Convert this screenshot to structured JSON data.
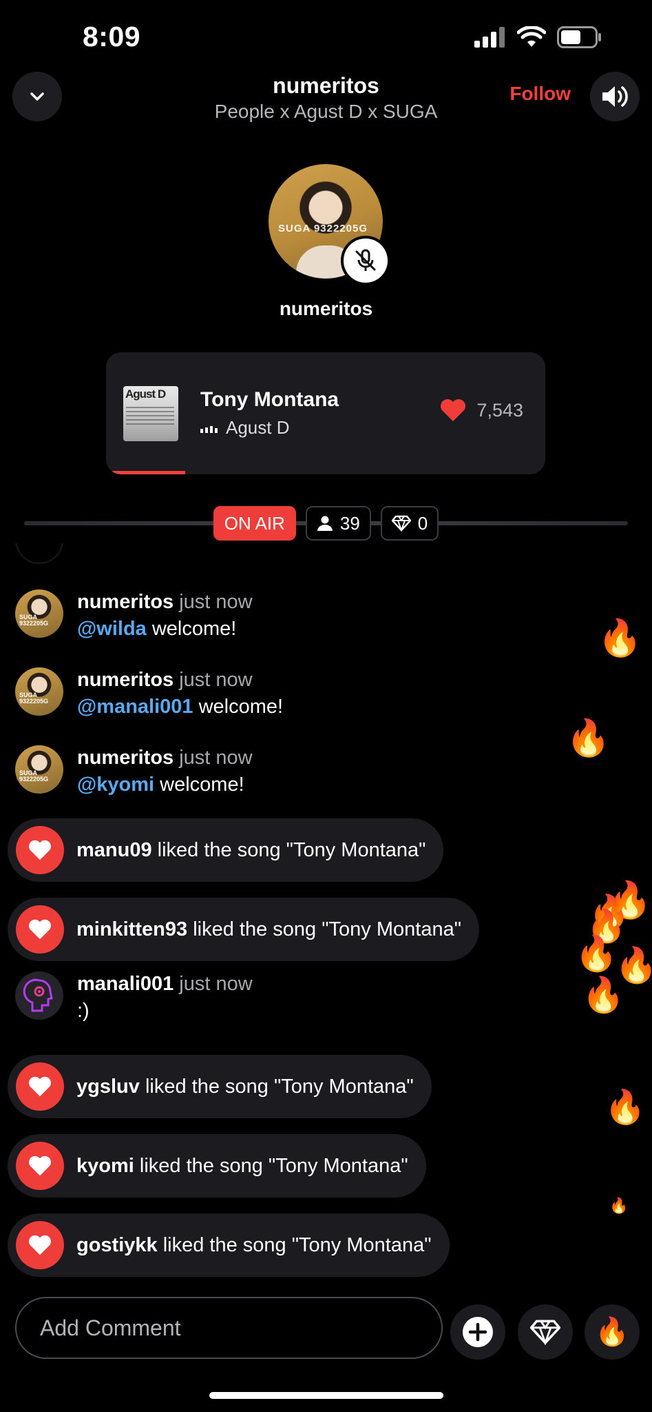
{
  "status_bar": {
    "time": "8:09"
  },
  "header": {
    "title": "numeritos",
    "subtitle": "People x Agust D x SUGA",
    "follow_label": "Follow"
  },
  "host": {
    "name": "numeritos",
    "avatar_text": "SUGA 9322205G",
    "muted": true
  },
  "now_playing": {
    "art_text": "Agust D",
    "title": "Tony Montana",
    "artist": "Agust D",
    "likes": "7,543",
    "progress": 0.18
  },
  "live_stats": {
    "on_air_label": "ON AIR",
    "listeners": "39",
    "diamonds": "0"
  },
  "chat": {
    "messages": [
      {
        "user": "numeritos",
        "time": "just now",
        "mention": "@wilda",
        "text": "welcome!"
      },
      {
        "user": "numeritos",
        "time": "just now",
        "mention": "@manali001",
        "text": "welcome!"
      },
      {
        "user": "numeritos",
        "time": "just now",
        "mention": "@kyomi",
        "text": "welcome!"
      }
    ],
    "likes_a": [
      {
        "user": "manu09",
        "text": "liked the song \"Tony Montana\""
      },
      {
        "user": "minkitten93",
        "text": "liked the song \"Tony Montana\""
      }
    ],
    "message_manali": {
      "user": "manali001",
      "time": "just now",
      "text": ":)"
    },
    "likes_b": [
      {
        "user": "ygsluv",
        "text": "liked the song \"Tony Montana\""
      },
      {
        "user": "kyomi",
        "text": "liked the song \"Tony Montana\""
      },
      {
        "user": "gostiykk",
        "text": "liked the song \"Tony Montana\""
      }
    ]
  },
  "composer": {
    "placeholder": "Add Comment"
  },
  "icons": {
    "collapse": "chevron-down-icon",
    "volume": "speaker-icon",
    "mute": "mic-off-icon",
    "like": "heart-icon",
    "listeners": "person-icon",
    "diamond": "diamond-icon",
    "add": "plus-icon",
    "fire": "fire-icon"
  },
  "colors": {
    "accent": "#ef3d3a",
    "mention": "#5aa9f0",
    "card": "#1c1c20"
  }
}
